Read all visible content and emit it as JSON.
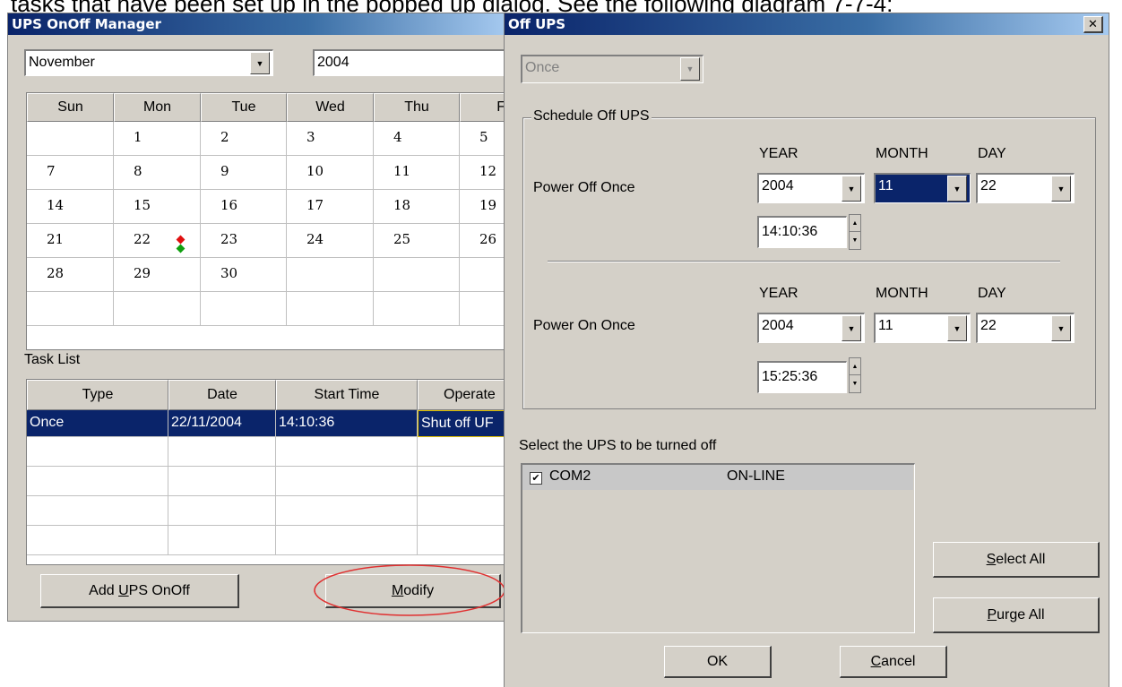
{
  "doc_text": "tasks that have been set up in the popped up dialog. See the following diagram 7-7-4:",
  "manager": {
    "title": "UPS OnOff Manager",
    "month": "November",
    "year": "2004",
    "weekdays": [
      "Sun",
      "Mon",
      "Tue",
      "Wed",
      "Thu",
      "F"
    ],
    "weeks": [
      [
        "",
        "1",
        "2",
        "3",
        "4",
        "5"
      ],
      [
        "7",
        "8",
        "9",
        "10",
        "11",
        "12"
      ],
      [
        "14",
        "15",
        "16",
        "17",
        "18",
        "19"
      ],
      [
        "21",
        "22",
        "23",
        "24",
        "25",
        "26"
      ],
      [
        "28",
        "29",
        "30",
        "",
        "",
        ""
      ],
      [
        "",
        "",
        "",
        "",
        "",
        ""
      ]
    ],
    "task_list_label": "Task List",
    "task_headers": [
      "Type",
      "Date",
      "Start Time",
      "Operate"
    ],
    "task_row": {
      "type": "Once",
      "date": "22/11/2004",
      "start": "14:10:36",
      "operate": "Shut off UF"
    },
    "add_button": "Add UPS OnOff",
    "add_button_mnemonic": "U",
    "modify_button": "Modify",
    "modify_button_mnemonic": "M"
  },
  "dialog": {
    "title": "Off UPS",
    "close_glyph": "✕",
    "mode": "Once",
    "group_label": "Schedule Off UPS",
    "year_label": "YEAR",
    "month_label": "MONTH",
    "day_label": "DAY",
    "off_label": "Power Off Once",
    "off_year": "2004",
    "off_month": "11",
    "off_day": "22",
    "off_time": "14:10:36",
    "on_label": "Power On Once",
    "on_year": "2004",
    "on_month": "11",
    "on_day": "22",
    "on_time": "15:25:36",
    "select_label": "Select the UPS to be turned off",
    "ups_name": "COM2",
    "ups_status": "ON-LINE",
    "select_all": "Select All",
    "select_all_mnemonic": "S",
    "purge_all": "Purge All",
    "purge_all_mnemonic": "P",
    "ok": "OK",
    "cancel": "Cancel",
    "cancel_mnemonic": "C"
  },
  "colors": {
    "accent": "#0a246a",
    "face": "#d4d0c8",
    "annotation": "#e03030",
    "marker_red": "#e01010",
    "marker_green": "#10a010"
  }
}
